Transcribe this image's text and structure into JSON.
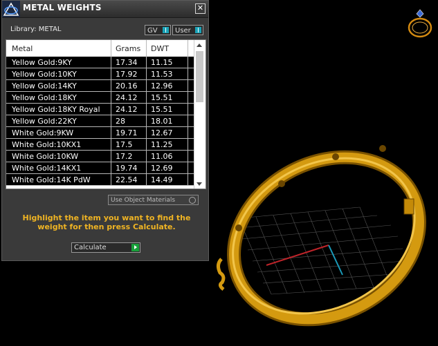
{
  "panel": {
    "title": "METAL WEIGHTS",
    "close_label": "✕",
    "library_label": "Library: METAL",
    "toggles": [
      {
        "label": "GV"
      },
      {
        "label": "User"
      }
    ],
    "table": {
      "columns": [
        "Metal",
        "Grams",
        "DWT"
      ],
      "rows": [
        {
          "metal": "Yellow Gold:9KY",
          "grams": "17.34",
          "dwt": "11.15"
        },
        {
          "metal": "Yellow Gold:10KY",
          "grams": "17.92",
          "dwt": "11.53"
        },
        {
          "metal": "Yellow Gold:14KY",
          "grams": "20.16",
          "dwt": "12.96"
        },
        {
          "metal": "Yellow Gold:18KY",
          "grams": "24.12",
          "dwt": "15.51"
        },
        {
          "metal": "Yellow Gold:18KY Royal",
          "grams": "24.12",
          "dwt": "15.51"
        },
        {
          "metal": "Yellow Gold:22KY",
          "grams": "28",
          "dwt": "18.01"
        },
        {
          "metal": "White Gold:9KW",
          "grams": "19.71",
          "dwt": "12.67"
        },
        {
          "metal": "White Gold:10KX1",
          "grams": "17.5",
          "dwt": "11.25"
        },
        {
          "metal": "White Gold:10KW",
          "grams": "17.2",
          "dwt": "11.06"
        },
        {
          "metal": "White Gold:14KX1",
          "grams": "19.74",
          "dwt": "12.69"
        },
        {
          "metal": "White Gold:14K PdW",
          "grams": "22.54",
          "dwt": "14.49"
        }
      ]
    },
    "use_object_materials_label": "Use Object Materials",
    "instruction": "Highlight the item you want to find the weight for then press Calculate.",
    "calculate_label": "Calculate"
  },
  "colors": {
    "accent": "#f0b423",
    "knob": "#1aa3b8",
    "go": "#18a03a",
    "bangle": "#d49a10"
  },
  "icons": [
    "app-logo-icon",
    "close-icon",
    "ring-view-icon",
    "scroll-up-icon",
    "scroll-down-icon",
    "calculate-arrow-icon"
  ]
}
